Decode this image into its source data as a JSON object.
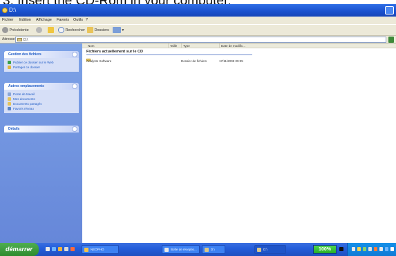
{
  "caption": "3. Insert the CD-Rom in your computer.",
  "window": {
    "title": "D:\\"
  },
  "menu": [
    "Fichier",
    "Edition",
    "Affichage",
    "Favoris",
    "Outils",
    "?"
  ],
  "toolbar": {
    "back": "Précédente",
    "search": "Rechercher",
    "folders": "Dossiers"
  },
  "address": {
    "label": "Adresse",
    "value": "D:\\"
  },
  "taskpane": {
    "file_tasks": {
      "title": "Gestion des fichiers",
      "items": [
        "Publier ce dossier sur le Web",
        "Partager ce dossier"
      ]
    },
    "other_places": {
      "title": "Autres emplacements",
      "items": [
        "Poste de travail",
        "Mes documents",
        "Documents partagés",
        "Favoris réseau"
      ]
    },
    "details": {
      "title": "Détails"
    }
  },
  "columns": [
    "Nom",
    "Taille",
    "Type",
    "Date de modific..."
  ],
  "group_title": "Fichiers actuellement sur le CD",
  "files": [
    {
      "name": "Analyste Software",
      "size": "",
      "type": "Dossier de fichiers",
      "date": "17/11/2008 09:35"
    }
  ],
  "taskbar": {
    "start": "démarrer",
    "tasks": [
      "NEOPHO",
      "Boîte de réceptio...",
      "D:\\",
      "D:\\"
    ],
    "progress": {
      "value": 100,
      "label": "100%"
    }
  },
  "colors": {
    "title_blue": "#1b52cf",
    "pane_blue": "#6f92dc",
    "start_green": "#3a9b3a",
    "progress_green": "#2fbf2f"
  }
}
